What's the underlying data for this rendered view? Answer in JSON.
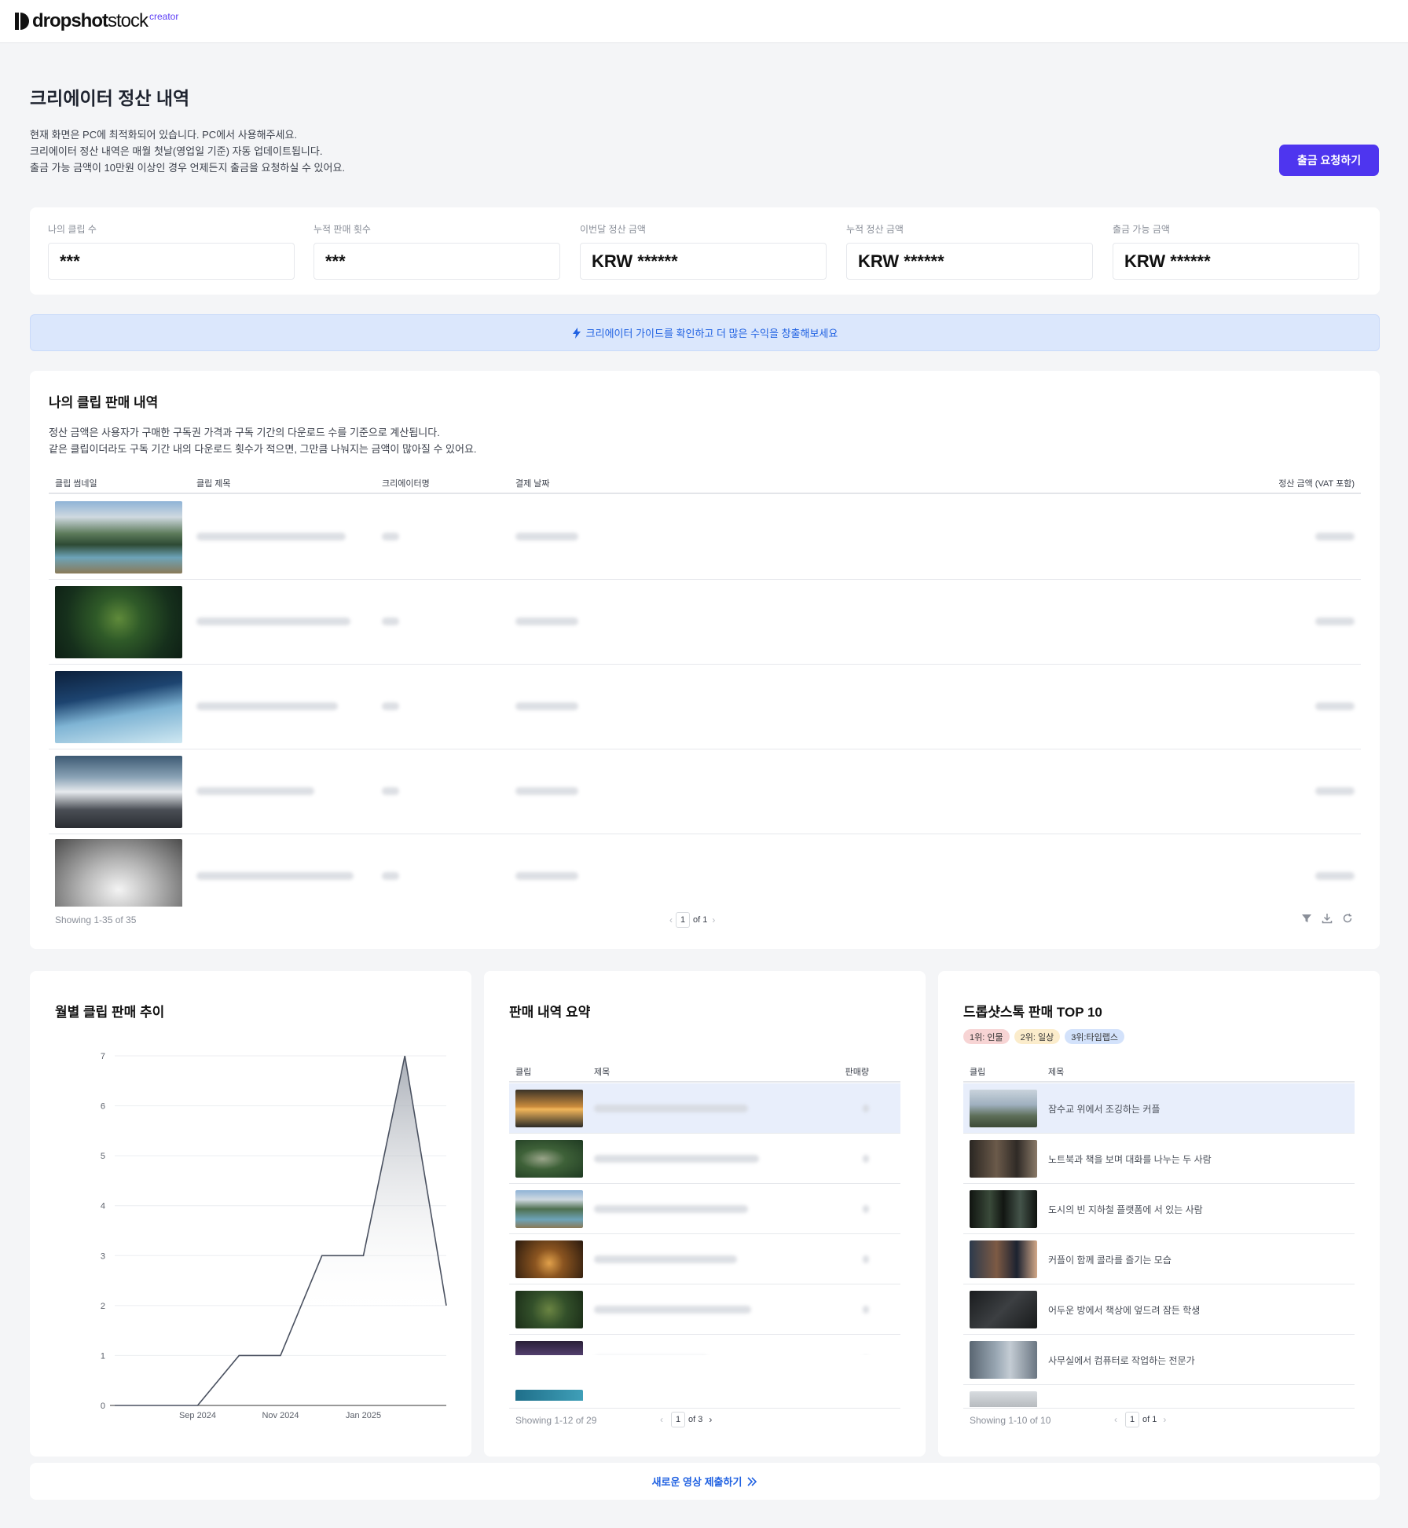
{
  "header": {
    "logo_bold": "dropshot",
    "logo_light": "stock",
    "logo_sup": "creator"
  },
  "page": {
    "title": "크리에이터 정산 내역",
    "notices": [
      "현재 화면은 PC에 최적화되어 있습니다. PC에서 사용해주세요.",
      "크리에이터 정산 내역은 매월 첫날(영업일 기준) 자동 업데이트됩니다.",
      "출금 가능 금액이 10만원 이상인 경우 언제든지 출금을 요청하실 수 있어요."
    ],
    "withdraw_button": "출금 요청하기"
  },
  "stats": [
    {
      "label": "나의 클립 수",
      "value": "***"
    },
    {
      "label": "누적 판매 횟수",
      "value": "***"
    },
    {
      "label": "이번달 정산 금액",
      "value": "KRW ******"
    },
    {
      "label": "누적 정산 금액",
      "value": "KRW ******"
    },
    {
      "label": "출금 가능 금액",
      "value": "KRW ******"
    }
  ],
  "guide_banner": {
    "icon": "lightning-icon",
    "text": "크리에이터 가이드를 확인하고 더 많은 수익을 창출해보세요",
    "color": "#2162e2"
  },
  "sales": {
    "title": "나의 클립 판매 내역",
    "desc": [
      "정산 금액은 사용자가 구매한 구독권 가격과 구독 기간의 다운로드 수를 기준으로 계산됩니다.",
      "같은 클립이더라도 구독 기간 내의 다운로드 횟수가 적으면, 그만큼 나눠지는 금액이 많아질 수 있어요."
    ],
    "columns": [
      "클립 썸네일",
      "클립 제목",
      "크리에이터명",
      "결제 날짜",
      "정산 금액 (VAT 포함)"
    ],
    "rows": [
      {
        "thumbnail": "mountain-river"
      },
      {
        "thumbnail": "moss-sprout"
      },
      {
        "thumbnail": "ice-crystals"
      },
      {
        "thumbnail": "snowy-peaks"
      },
      {
        "thumbnail": "misty-rock"
      }
    ],
    "footer_text": "Showing 1-35 of 35",
    "page_current": "1",
    "page_total": "of 1",
    "tool_icons": [
      "filter-icon",
      "download-icon",
      "refresh-icon"
    ]
  },
  "monthly_chart": {
    "title": "월별 클립 판매 추이"
  },
  "chart_data": {
    "type": "area",
    "x": [
      "Jul 2024",
      "Aug 2024",
      "Sep 2024",
      "Oct 2024",
      "Nov 2024",
      "Dec 2024",
      "Jan 2025",
      "Feb 2025",
      "Mar 2025"
    ],
    "x_tick_labels": [
      "Sep 2024",
      "Nov 2024",
      "Jan 2025"
    ],
    "values": [
      0,
      0,
      0,
      1,
      1,
      3,
      3,
      7,
      2
    ],
    "ylim": [
      0,
      7
    ],
    "yticks": [
      0,
      1,
      2,
      3,
      4,
      5,
      6,
      7
    ],
    "grid": true,
    "line_color": "#4a5160"
  },
  "summary": {
    "title": "판매 내역 요약",
    "columns": [
      "클립",
      "제목",
      "판매량"
    ],
    "rows": [
      {
        "thumbnail": "sunset-sea",
        "highlight": true
      },
      {
        "thumbnail": "forest-road",
        "highlight": false
      },
      {
        "thumbnail": "mountain-river",
        "highlight": false
      },
      {
        "thumbnail": "golden-grass",
        "highlight": false
      },
      {
        "thumbnail": "moss-field",
        "highlight": false
      },
      {
        "thumbnail": "lightning-sky",
        "highlight": false
      },
      {
        "thumbnail": "ocean-wave",
        "highlight": false
      }
    ],
    "footer_text": "Showing 1-12 of 29",
    "page_current": "1",
    "page_total": "of 3"
  },
  "top10": {
    "title": "드롭샷스톡 판매 TOP 10",
    "badges": [
      {
        "label": "1위: 인물",
        "color": "#f7d4d4"
      },
      {
        "label": "2위: 일상",
        "color": "#fbeccb"
      },
      {
        "label": "3위:타임랩스",
        "color": "#d3e2fb"
      }
    ],
    "columns": [
      "클립",
      "제목"
    ],
    "rows": [
      {
        "thumbnail": "couple-riverside",
        "title": "잠수교 위에서 조깅하는 커플",
        "highlight": true
      },
      {
        "thumbnail": "two-people-laptop",
        "title": "노트북과 책을 보며 대화를 나누는 두 사람",
        "highlight": false
      },
      {
        "thumbnail": "subway-platform",
        "title": "도시의 빈 지하철 플랫폼에 서 있는 사람",
        "highlight": false
      },
      {
        "thumbnail": "couple-cola",
        "title": "커플이 함께 콜라를 즐기는 모습",
        "highlight": false
      },
      {
        "thumbnail": "student-asleep",
        "title": "어두운 방에서 책상에 엎드려 잠든 학생",
        "highlight": false
      },
      {
        "thumbnail": "office-computer",
        "title": "사무실에서 컴퓨터로 작업하는 전문가",
        "highlight": false
      },
      {
        "thumbnail": "person-portrait",
        "title": "",
        "highlight": false
      }
    ],
    "footer_text": "Showing 1-10 of 10",
    "page_current": "1",
    "page_total": "of 1"
  },
  "submit_bar": {
    "label": "새로운 영상 제출하기",
    "icon": "double-chevron-right-icon"
  }
}
